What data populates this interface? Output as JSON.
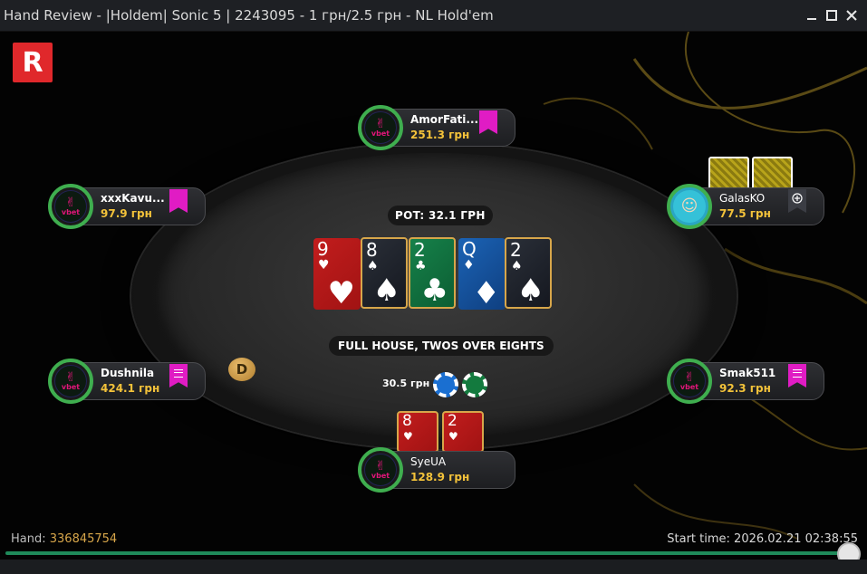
{
  "window": {
    "title": "Hand Review - |Holdem| Sonic 5 | 2243095 - 1 грн/2.5 грн - NL Hold'em",
    "minimize_icon": "minimize-icon",
    "maximize_icon": "maximize-icon",
    "close_icon": "close-icon"
  },
  "brand": {
    "logo_letter": "R",
    "color": "#e0282b"
  },
  "table": {
    "pot_label": "POT: 32.1 ГРН",
    "hand_rank": "FULL HOUSE, TWOS OVER EIGHTS",
    "dealer_button": "D",
    "bet_amount": "30.5 грн",
    "board": [
      {
        "rank": "9",
        "suit": "♥",
        "color": "red",
        "highlighted": false
      },
      {
        "rank": "8",
        "suit": "♠",
        "color": "black",
        "highlighted": true
      },
      {
        "rank": "2",
        "suit": "♣",
        "color": "green",
        "highlighted": true
      },
      {
        "rank": "Q",
        "suit": "♦",
        "color": "blue",
        "highlighted": false
      },
      {
        "rank": "2",
        "suit": "♠",
        "color": "black",
        "highlighted": true
      }
    ]
  },
  "players": [
    {
      "id": "amorfati",
      "name": "AmorFati...",
      "stack": "251.3 грн",
      "tag": "pink",
      "avatar": "vbet"
    },
    {
      "id": "xxxkavu",
      "name": "xxxKavu...",
      "stack": "97.9 грн",
      "tag": "pink",
      "avatar": "vbet"
    },
    {
      "id": "galasko",
      "name": "GalasKO",
      "stack": "77.5 грн",
      "tag": "plus",
      "avatar": "girl"
    },
    {
      "id": "dushnila",
      "name": "Dushnila",
      "stack": "424.1 грн",
      "tag": "notes",
      "avatar": "vbet"
    },
    {
      "id": "smak511",
      "name": "Smak511",
      "stack": "92.3 грн",
      "tag": "notes",
      "avatar": "vbet"
    },
    {
      "id": "syeua",
      "name": "SyeUA",
      "stack": "128.9 грн",
      "tag": "none",
      "avatar": "vbet",
      "hole_cards": [
        {
          "rank": "8",
          "suit": "♥"
        },
        {
          "rank": "2",
          "suit": "♥"
        }
      ]
    }
  ],
  "avatar_text": "vbet",
  "footer": {
    "hand_label": "Hand:",
    "hand_number": "336845754",
    "start_time_label": "Start time:",
    "start_time": "2026.02.21 02:38:55",
    "progress": 1.0
  },
  "colors": {
    "accent": "#d7a64a",
    "stack": "#f3c23a",
    "tag": "#e01cc4",
    "progress": "#1f8a5a"
  }
}
